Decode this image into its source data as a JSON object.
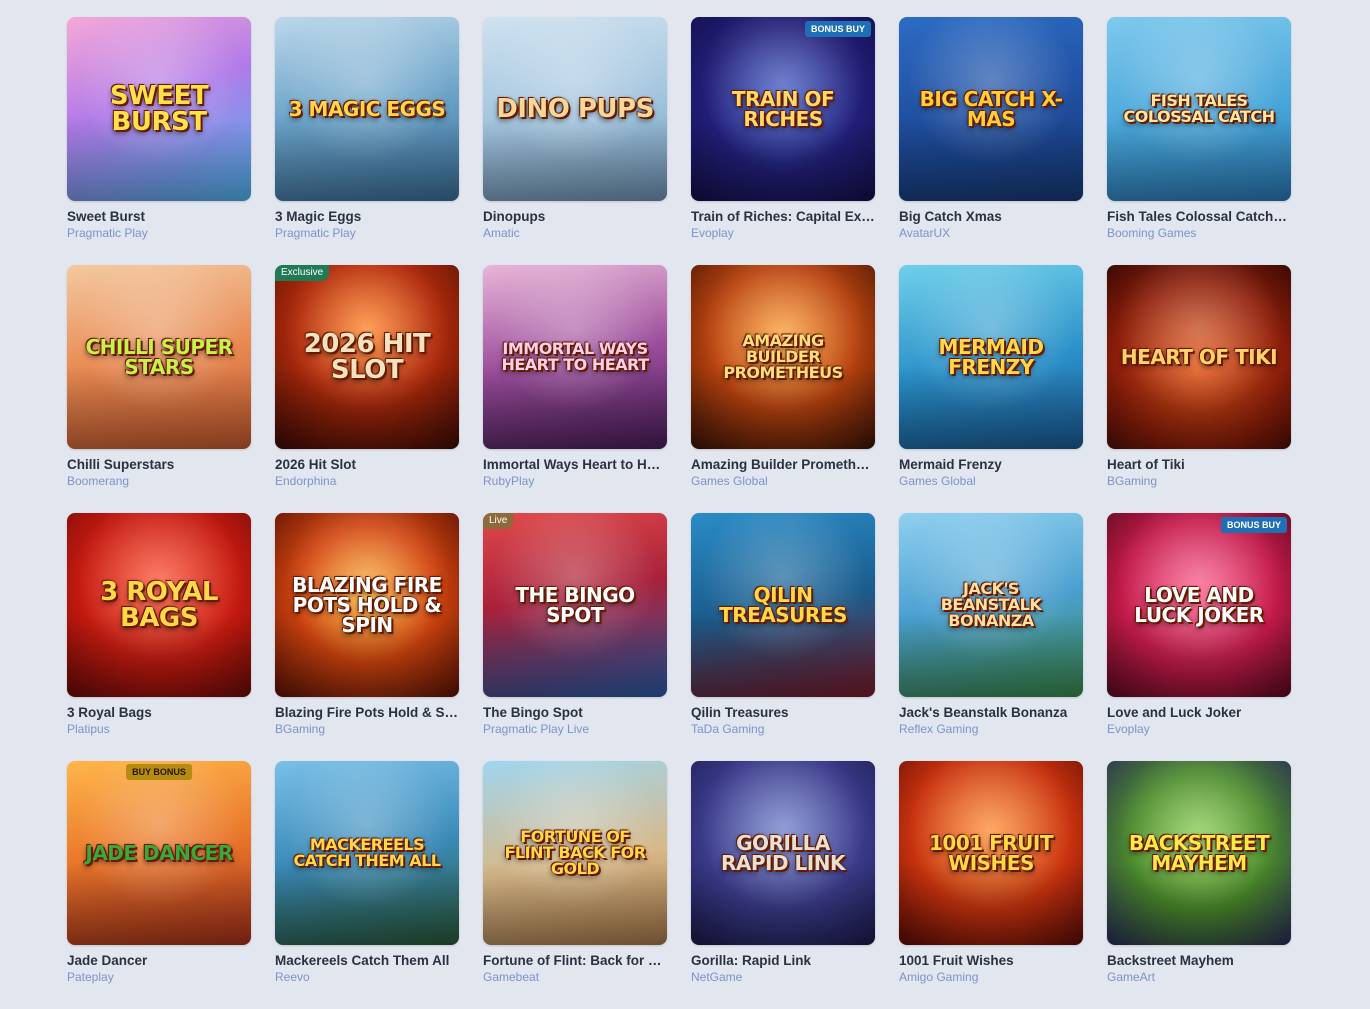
{
  "games": [
    {
      "title": "Sweet Burst",
      "provider": "Pragmatic Play",
      "art": "Sweet BURST",
      "bg": "linear-gradient(160deg,#f6a8d8 0%,#b07ae8 45%,#4fb5f0 100%)",
      "fg": "#ffe14a",
      "size": "",
      "badge": ""
    },
    {
      "title": "3 Magic Eggs",
      "provider": "Pragmatic Play",
      "art": "3 MAGIC EGGS",
      "bg": "linear-gradient(170deg,#bcd8ea 0%,#6aa2c8 50%,#3b6f9a 100%)",
      "fg": "#ffd54a",
      "size": "small",
      "badge": ""
    },
    {
      "title": "Dinopups",
      "provider": "Amatic",
      "art": "DINO PUPS",
      "bg": "linear-gradient(170deg,#cfe2f0 0%,#9fc2dc 55%,#6f93b4 100%)",
      "fg": "#f6d79a",
      "size": "",
      "badge": ""
    },
    {
      "title": "Train of Riches: Capital Express",
      "provider": "Evoplay",
      "art": "TRAIN OF RICHES",
      "bg": "radial-gradient(circle at 50% 45%,#3a58c8 0%,#221e78 55%,#12104a 100%)",
      "fg": "#ffd86a",
      "size": "small",
      "badge": "BONUS BUY",
      "badge_pos": "tr"
    },
    {
      "title": "Big Catch Xmas",
      "provider": "AvatarUX",
      "art": "BIG CATCH X-MAS",
      "bg": "linear-gradient(170deg,#2d6cc4 0%,#1e4c9c 55%,#173a78 100%)",
      "fg": "#ffcf3a",
      "size": "small",
      "badge": ""
    },
    {
      "title": "Fish Tales Colossal Catch: Link & Loot",
      "provider": "Booming Games",
      "art": "FISH TALES COLOSSAL CATCH",
      "bg": "linear-gradient(170deg,#7fc9ee 0%,#47a5d8 55%,#2a7ab8 100%)",
      "fg": "#ffe7a0",
      "size": "xsmall",
      "badge": ""
    },
    {
      "title": "Chilli Superstars",
      "provider": "Boomerang",
      "art": "CHILLI SUPER STARS",
      "bg": "linear-gradient(170deg,#f4c9a0 0%,#e88a52 50%,#c85a2e 100%)",
      "fg": "#c8f24a",
      "size": "small",
      "badge": ""
    },
    {
      "title": "2026 Hit Slot",
      "provider": "Endorphina",
      "art": "2026 HIT SLOT",
      "bg": "radial-gradient(circle at 50% 35%,#ff7a1a 0%,#b32b0a 45%,#3a0a06 100%)",
      "fg": "#f2e2c0",
      "size": "",
      "badge": "Exclusive",
      "badge_pos": "tl"
    },
    {
      "title": "Immortal Ways Heart to Heart",
      "provider": "RubyPlay",
      "art": "IMMORTAL WAYS HEART TO HEART",
      "bg": "linear-gradient(170deg,#e8b7d8 0%,#9c4e9c 50%,#4a1e5c 100%)",
      "fg": "#ffd1e8",
      "size": "xsmall",
      "badge": ""
    },
    {
      "title": "Amazing Builder Prometheus",
      "provider": "Games Global",
      "art": "AMAZING BUILDER PROMETHEUS",
      "bg": "radial-gradient(circle at 50% 40%,#ff9a2a 0%,#b8420e 50%,#3a1206 100%)",
      "fg": "#ffe07a",
      "size": "xsmall",
      "badge": ""
    },
    {
      "title": "Mermaid Frenzy",
      "provider": "Games Global",
      "art": "MERMAID FRENZY",
      "bg": "linear-gradient(170deg,#6fd0ea 0%,#2a8fc8 55%,#1a5c98 100%)",
      "fg": "#ffd84a",
      "size": "small",
      "badge": ""
    },
    {
      "title": "Heart of Tiki",
      "provider": "BGaming",
      "art": "HEART OF TIKI",
      "bg": "radial-gradient(circle at 50% 55%,#e85a1a 0%,#8e1e0a 60%,#3a0a04 100%)",
      "fg": "#ffd36a",
      "size": "small",
      "badge": ""
    },
    {
      "title": "3 Royal Bags",
      "provider": "Platipus",
      "art": "3 ROYAL BAGS",
      "bg": "radial-gradient(circle at 50% 40%,#ff4a2a 0%,#c41a10 55%,#6a0a06 100%)",
      "fg": "#ffd84a",
      "size": "",
      "badge": ""
    },
    {
      "title": "Blazing Fire Pots Hold & Spin",
      "provider": "BGaming",
      "art": "BLAZING FIRE POTS HOLD & SPIN",
      "bg": "radial-gradient(circle at 50% 45%,#ffb02a 0%,#d2440e 50%,#5a1206 100%)",
      "fg": "#ffffff",
      "size": "small",
      "badge": ""
    },
    {
      "title": "The Bingo Spot",
      "provider": "Pragmatic Play Live",
      "art": "THE BINGO SPOT",
      "bg": "linear-gradient(170deg,#e04a4a 0%,#a8203a 45%,#2a5ca8 100%)",
      "fg": "#ffffff",
      "size": "small",
      "badge": "Live",
      "badge_pos": "live"
    },
    {
      "title": "Qilin Treasures",
      "provider": "TaDa Gaming",
      "art": "QILIN TREASURES",
      "bg": "linear-gradient(170deg,#2a8cc8 0%,#1a5c8c 50%,#7a1a2a 100%)",
      "fg": "#ffd84a",
      "size": "small",
      "badge": ""
    },
    {
      "title": "Jack's Beanstalk Bonanza",
      "provider": "Reflex Gaming",
      "art": "JACK'S BEANSTALK BONANZA",
      "bg": "linear-gradient(170deg,#8fd0f0 0%,#4a9fd0 50%,#3a8a4a 100%)",
      "fg": "#ffe0a0",
      "size": "xsmall",
      "badge": ""
    },
    {
      "title": "Love and Luck Joker",
      "provider": "Evoplay",
      "art": "LOVE AND LUCK JOKER",
      "bg": "radial-gradient(circle at 50% 45%,#ff5a8c 0%,#c41a4a 55%,#5a0a1e 100%)",
      "fg": "#ffffff",
      "size": "small",
      "badge": "BONUS BUY",
      "badge_pos": "tr"
    },
    {
      "title": "Jade Dancer",
      "provider": "Pateplay",
      "art": "JADE DANCER",
      "bg": "linear-gradient(170deg,#ffb64a 0%,#e8742a 50%,#a8301a 100%)",
      "fg": "#3aa83a",
      "size": "small",
      "badge": "BUY BONUS",
      "badge_pos": "tc"
    },
    {
      "title": "Mackereels Catch Them All",
      "provider": "Reevo",
      "art": "MACKEREELS CATCH THEM ALL",
      "bg": "linear-gradient(170deg,#7ac0e8 0%,#3a8ab8 50%,#2a5a3a 100%)",
      "fg": "#ffd84a",
      "size": "xsmall",
      "badge": ""
    },
    {
      "title": "Fortune of Flint: Back for Gold",
      "provider": "Gamebeat",
      "art": "FORTUNE OF FLINT BACK FOR GOLD",
      "bg": "linear-gradient(170deg,#9fd6f0 0%,#d8b888 55%,#a87a4a 100%)",
      "fg": "#ffd84a",
      "size": "xsmall",
      "badge": ""
    },
    {
      "title": "Gorilla: Rapid Link",
      "provider": "NetGame",
      "art": "GORILLA RAPID LINK",
      "bg": "radial-gradient(circle at 50% 40%,#6a7ac8 0%,#3a3a8a 55%,#1a1a4a 100%)",
      "fg": "#e8e0d0",
      "size": "small",
      "badge": ""
    },
    {
      "title": "1001 Fruit Wishes",
      "provider": "Amigo Gaming",
      "art": "1001 FRUIT WISHES",
      "bg": "radial-gradient(circle at 50% 40%,#ff8a2a 0%,#c8320e 55%,#5a0a06 100%)",
      "fg": "#ffd84a",
      "size": "small",
      "badge": ""
    },
    {
      "title": "Backstreet Mayhem",
      "provider": "GameArt",
      "art": "BACKSTREET MAYHEM",
      "bg": "radial-gradient(circle at 50% 45%,#8ad04a 0%,#4a8a2a 50%,#2a2a5a 100%)",
      "fg": "#ffe84a",
      "size": "small",
      "badge": ""
    }
  ]
}
